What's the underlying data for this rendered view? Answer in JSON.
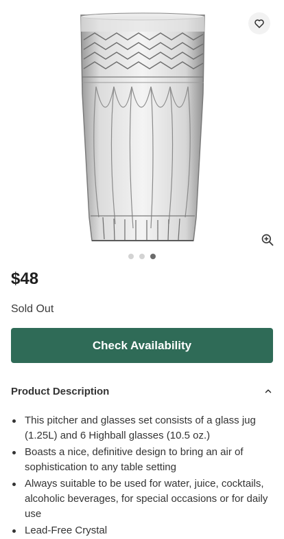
{
  "gallery": {
    "image_alt": "Crystal highball glass",
    "slide_count": 3,
    "active_slide": 3,
    "wishlist_icon": "heart-icon",
    "zoom_icon": "zoom-in-icon"
  },
  "product": {
    "price": "$48",
    "stock_status": "Sold Out"
  },
  "actions": {
    "check_availability_label": "Check Availability"
  },
  "description": {
    "title": "Product Description",
    "toggle_icon": "chevron-up-icon",
    "items": [
      "This pitcher and glasses set consists of a glass jug (1.25L) and 6 Highball glasses (10.5 oz.)",
      "Boasts a nice, definitive design to bring an air of sophistication to any table setting",
      "Always suitable to be used for water, juice, cocktails, alcoholic beverages, for special occasions or for daily use",
      "Lead-Free Crystal"
    ]
  },
  "colors": {
    "primary_button": "#2f6b57",
    "dot_active": "#6b6b6b",
    "dot_inactive": "#d3d3d3"
  }
}
